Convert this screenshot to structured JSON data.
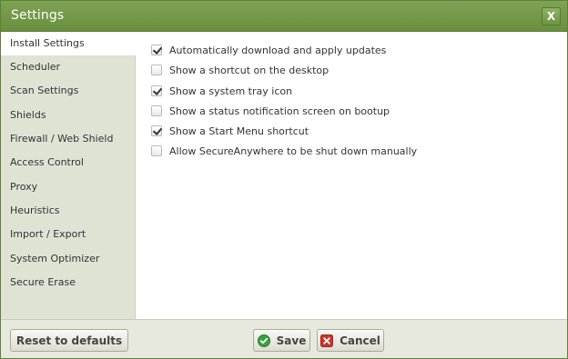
{
  "window": {
    "title": "Settings",
    "close_label": "X"
  },
  "sidebar": {
    "items": [
      {
        "label": "Install Settings",
        "active": true
      },
      {
        "label": "Scheduler"
      },
      {
        "label": "Scan Settings"
      },
      {
        "label": "Shields"
      },
      {
        "label": "Firewall / Web Shield"
      },
      {
        "label": "Access Control"
      },
      {
        "label": "Proxy"
      },
      {
        "label": "Heuristics"
      },
      {
        "label": "Import / Export"
      },
      {
        "label": "System Optimizer"
      },
      {
        "label": "Secure Erase"
      }
    ]
  },
  "options": [
    {
      "label": "Automatically download and apply updates",
      "checked": true
    },
    {
      "label": "Show a shortcut on the desktop",
      "checked": false
    },
    {
      "label": "Show a system tray icon",
      "checked": true
    },
    {
      "label": "Show a status notification screen on bootup",
      "checked": false
    },
    {
      "label": "Show a Start Menu shortcut",
      "checked": true
    },
    {
      "label": "Allow SecureAnywhere to be shut down manually",
      "checked": false
    }
  ],
  "footer": {
    "reset_label": "Reset to defaults",
    "save_label": "Save",
    "cancel_label": "Cancel",
    "save_icon": "green-check-circle-icon",
    "cancel_icon": "red-x-square-icon"
  },
  "colors": {
    "titlebar": "#6f9444",
    "sidebar_bg": "#dfe3d4",
    "footer_bg": "#e7e9de",
    "save_icon": "#3aa142",
    "cancel_icon": "#c8362d"
  }
}
